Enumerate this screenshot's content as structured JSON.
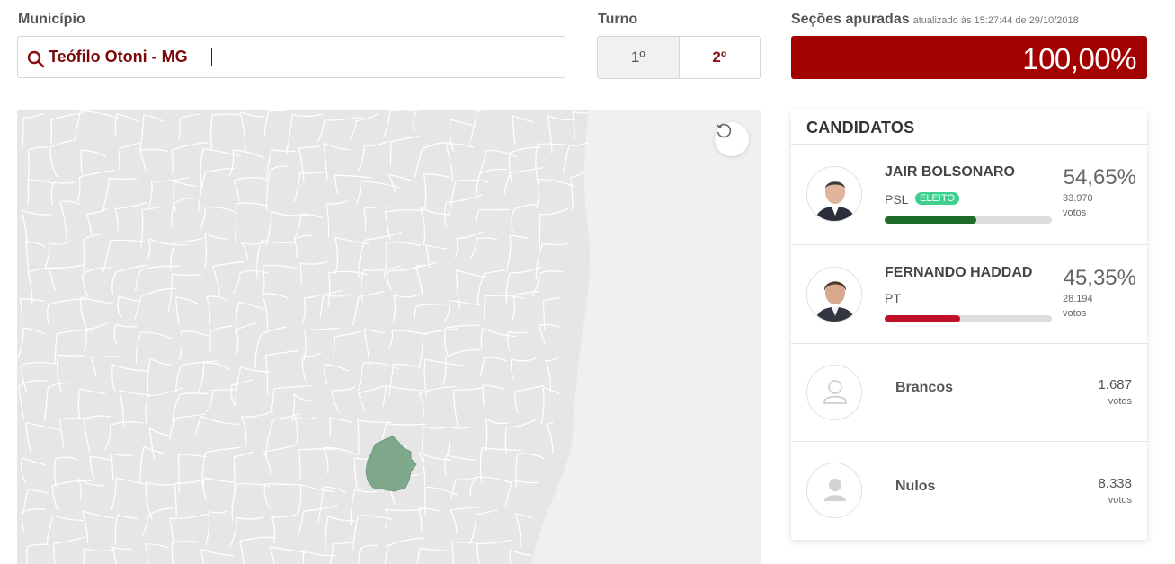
{
  "municipio": {
    "label": "Município",
    "value": "Teófilo Otoni - MG"
  },
  "turno": {
    "label": "Turno",
    "options": [
      "1º",
      "2º"
    ],
    "selected": "2º"
  },
  "secoes": {
    "label": "Seções apuradas",
    "updated": "atualizado às 15:27:44 de 29/10/2018",
    "value": "100,00%",
    "fraction": 1.0
  },
  "map": {
    "highlighted_color": "#7fa88a",
    "reset_icon": "reset-icon"
  },
  "candidatos": {
    "title": "CANDIDATOS",
    "items": [
      {
        "name": "JAIR BOLSONARO",
        "party": "PSL",
        "badge": "ELEITO",
        "percent": "54,65%",
        "votes": "33.970",
        "votes_label": "votos",
        "share": 0.5465,
        "bar_color": "#1c6b2a"
      },
      {
        "name": "FERNANDO HADDAD",
        "party": "PT",
        "percent": "45,35%",
        "votes": "28.194",
        "votes_label": "votos",
        "share": 0.4535,
        "bar_color": "#c0112b"
      }
    ],
    "others": [
      {
        "name": "Brancos",
        "votes": "1.687",
        "votes_label": "votos"
      },
      {
        "name": "Nulos",
        "votes": "8.338",
        "votes_label": "votos"
      }
    ]
  },
  "colors": {
    "accent": "#a30000",
    "eleito_badge": "#3ccf8e"
  }
}
